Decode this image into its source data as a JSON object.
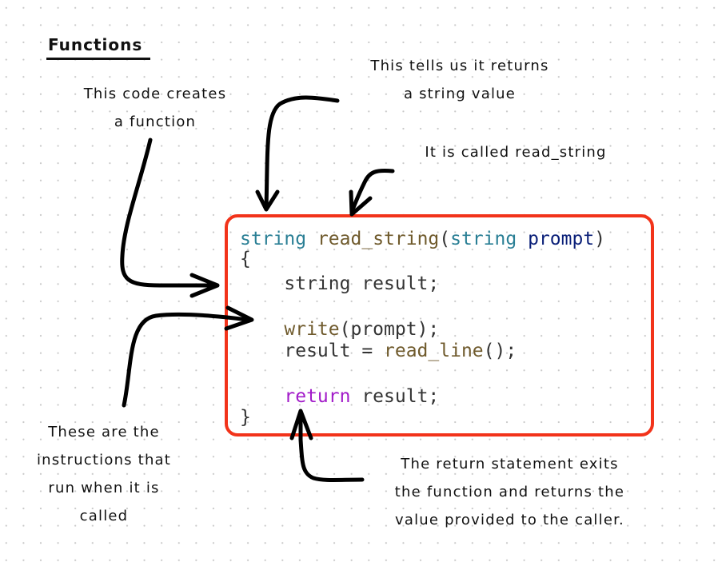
{
  "title": "Functions",
  "notes": {
    "creates_function": [
      "This code creates",
      "a function"
    ],
    "returns_string": [
      "This tells us it returns",
      "a string value"
    ],
    "called_name": [
      "It is called read_string"
    ],
    "instructions": [
      "These are the",
      "instructions that",
      "run when it is",
      "called"
    ],
    "return_statement": [
      "The return statement exits",
      "the function and returns the",
      "value provided to the caller."
    ]
  },
  "code": {
    "line1": {
      "return_type": "string",
      "sp1": " ",
      "function_name": "read_string",
      "open_paren": "(",
      "param_type": "string",
      "sp2": " ",
      "param_name": "prompt",
      "close_paren": ")"
    },
    "line2": "{",
    "line3": {
      "indent": "    ",
      "decl": "string result;"
    },
    "line4": {
      "indent": "    ",
      "call": "write",
      "rest": "(prompt);"
    },
    "line5": {
      "indent": "    ",
      "lhs": "result = ",
      "call": "read_line",
      "rest": "();"
    },
    "line6": {
      "indent": "    ",
      "keyword": "return",
      "rest": " result;"
    },
    "line7": "}"
  },
  "colors": {
    "box_border": "#f2331a",
    "type": "#2a7f95",
    "function": "#6f5a2c",
    "parameter": "#0a1f78",
    "keyword": "#a21bc9",
    "text": "#333333"
  }
}
